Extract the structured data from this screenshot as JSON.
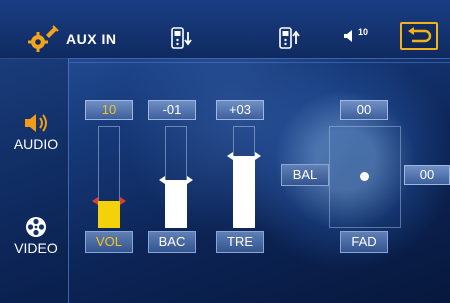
{
  "header": {
    "source_icon": "aux-settings-icon",
    "source_label": "AUX IN",
    "phone_down_icon": "phone-down-icon",
    "phone_up_icon": "phone-up-icon",
    "volume_icon": "speaker-volume-icon",
    "volume_level": "10",
    "back_icon": "back-icon"
  },
  "sidebar": {
    "items": [
      {
        "label": "AUDIO",
        "icon": "speaker-icon",
        "active": true
      },
      {
        "label": "VIDEO",
        "icon": "film-reel-icon",
        "active": false
      }
    ]
  },
  "controls": {
    "vol": {
      "label": "VOL",
      "value": "10",
      "level": 0.25
    },
    "bac": {
      "label": "BAC",
      "value": "-01",
      "level": 0.47
    },
    "tre": {
      "label": "TRE",
      "value": "+03",
      "level": 0.71
    },
    "bal": {
      "label": "BAL",
      "value": "00"
    },
    "fad": {
      "label": "FAD",
      "value": "00"
    }
  },
  "colors": {
    "accent": "#f5c516",
    "back_border": "#f2b21b",
    "vol_fill": "#f4d20a",
    "marker_red": "#e23b2f"
  }
}
